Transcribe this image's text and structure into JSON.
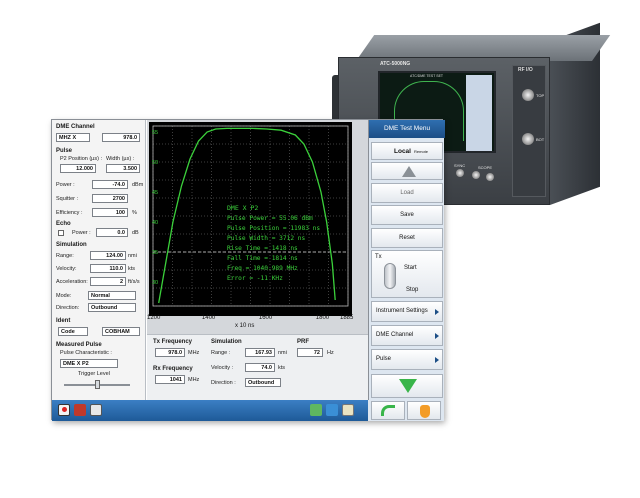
{
  "device": {
    "model_label": "ATC-5000NG",
    "screen_label": "ATC/DME TEST SET",
    "rf_label": "RF I/O",
    "port_top": "TOP",
    "port_bot": "BOT",
    "port_sync": "SYNC",
    "port_scope": "SCOPE"
  },
  "left_panel": {
    "dme_channel": {
      "title": "DME Channel",
      "mode": "MHZ X",
      "value": "978.0"
    },
    "pulse": {
      "title": "Pulse",
      "p2_position_label": "P2 Position (µs) :",
      "p2_position_value": "12.000",
      "width_label": "Width (µs) :",
      "width_value": "3.500",
      "power_label": "Power :",
      "power_value": "-74.0",
      "power_unit": "dBm",
      "squitter_label": "Squitter :",
      "squitter_value": "2700",
      "efficiency_label": "Efficiency :",
      "efficiency_value": "100",
      "efficiency_unit": "%"
    },
    "echo": {
      "title": "Echo",
      "power_label": "Power :",
      "power_value": "0.0",
      "power_unit": "dB"
    },
    "simulation": {
      "title": "Simulation",
      "range_label": "Range:",
      "range_value": "124.00",
      "range_unit": "nmi",
      "velocity_label": "Velocity:",
      "velocity_value": "110.0",
      "velocity_unit": "kts",
      "accel_label": "Acceleration:",
      "accel_value": "2",
      "accel_unit": "ft/s/s",
      "mode_label": "Mode:",
      "mode_value": "Normal",
      "direction_label": "Direction:",
      "direction_value": "Outbound"
    },
    "ident": {
      "title": "Ident",
      "code_label": "Code",
      "code_value": "COBHAM"
    },
    "measured_pulse": {
      "title": "Measured Pulse",
      "char_label": "Pulse Characteristic :",
      "char_value": "DME X P2",
      "trigger_label": "Trigger Level"
    }
  },
  "chart_data": {
    "type": "line",
    "xlabel": "x 10 ns",
    "x_ticks": [
      "1200",
      "1400",
      "1600",
      "1800",
      "1885"
    ],
    "y_ticks": [
      "55",
      "50",
      "45",
      "40",
      "35",
      "30"
    ],
    "xlim": [
      1200,
      1885
    ],
    "ylim": [
      26,
      56
    ],
    "threshold_y": 35,
    "series": [
      {
        "x": [
          1220,
          1270,
          1300,
          1330,
          1360,
          1390,
          1420,
          1460,
          1500,
          1550,
          1600,
          1650,
          1700,
          1730,
          1760,
          1790,
          1810,
          1830,
          1840
        ],
        "y": [
          26.5,
          40,
          46,
          50.5,
          53.5,
          55,
          55.5,
          55.6,
          55.6,
          55.6,
          55.5,
          55.3,
          54.5,
          53,
          50,
          45,
          40,
          33,
          27
        ]
      }
    ],
    "annotation": {
      "title": "DME X P2",
      "lines": [
        "Pulse Power = 55.06 dBm",
        "Pulse Position = 11983 ns",
        "Pulse Width = 3712 ns",
        "Rise Time = 1418 ns",
        "Fall Time = 1814 ns",
        "Freq = 1040.989 MHz",
        "Error = -11 KHz"
      ]
    }
  },
  "info_panel": {
    "tx_freq_label": "Tx Frequency",
    "tx_freq_value": "978.0",
    "tx_freq_unit": "MHz",
    "rx_freq_label": "Rx Frequency",
    "rx_freq_value": "1041",
    "rx_freq_unit": "MHz",
    "sim_title": "Simulation",
    "range_label": "Range :",
    "range_value": "167.93",
    "range_unit": "nmi",
    "velocity_label": "Velocity :",
    "velocity_value": "74.0",
    "velocity_unit": "kts",
    "direction_label": "Direction :",
    "direction_value": "Outbound",
    "prf_label": "PRF",
    "prf_value": "72",
    "prf_unit": "Hz"
  },
  "menu": {
    "title": "DME Test Menu",
    "local_label": "Local",
    "remote_label": "Remote",
    "load_label": "Load",
    "save_label": "Save",
    "reset_label": "Reset",
    "tx_label": "Tx",
    "start_label": "Start",
    "stop_label": "Stop",
    "instrument_settings": "Instrument Settings",
    "dme_channel": "DME Channel",
    "pulse": "Pulse"
  },
  "colors": {
    "plot_bg": "#000000",
    "trace": "#3bd13b",
    "grid": "#7d7d7d",
    "menu_header": "#1c4e86",
    "down_arrow": "#39b54a",
    "taskbar": "#2a6cb0"
  }
}
